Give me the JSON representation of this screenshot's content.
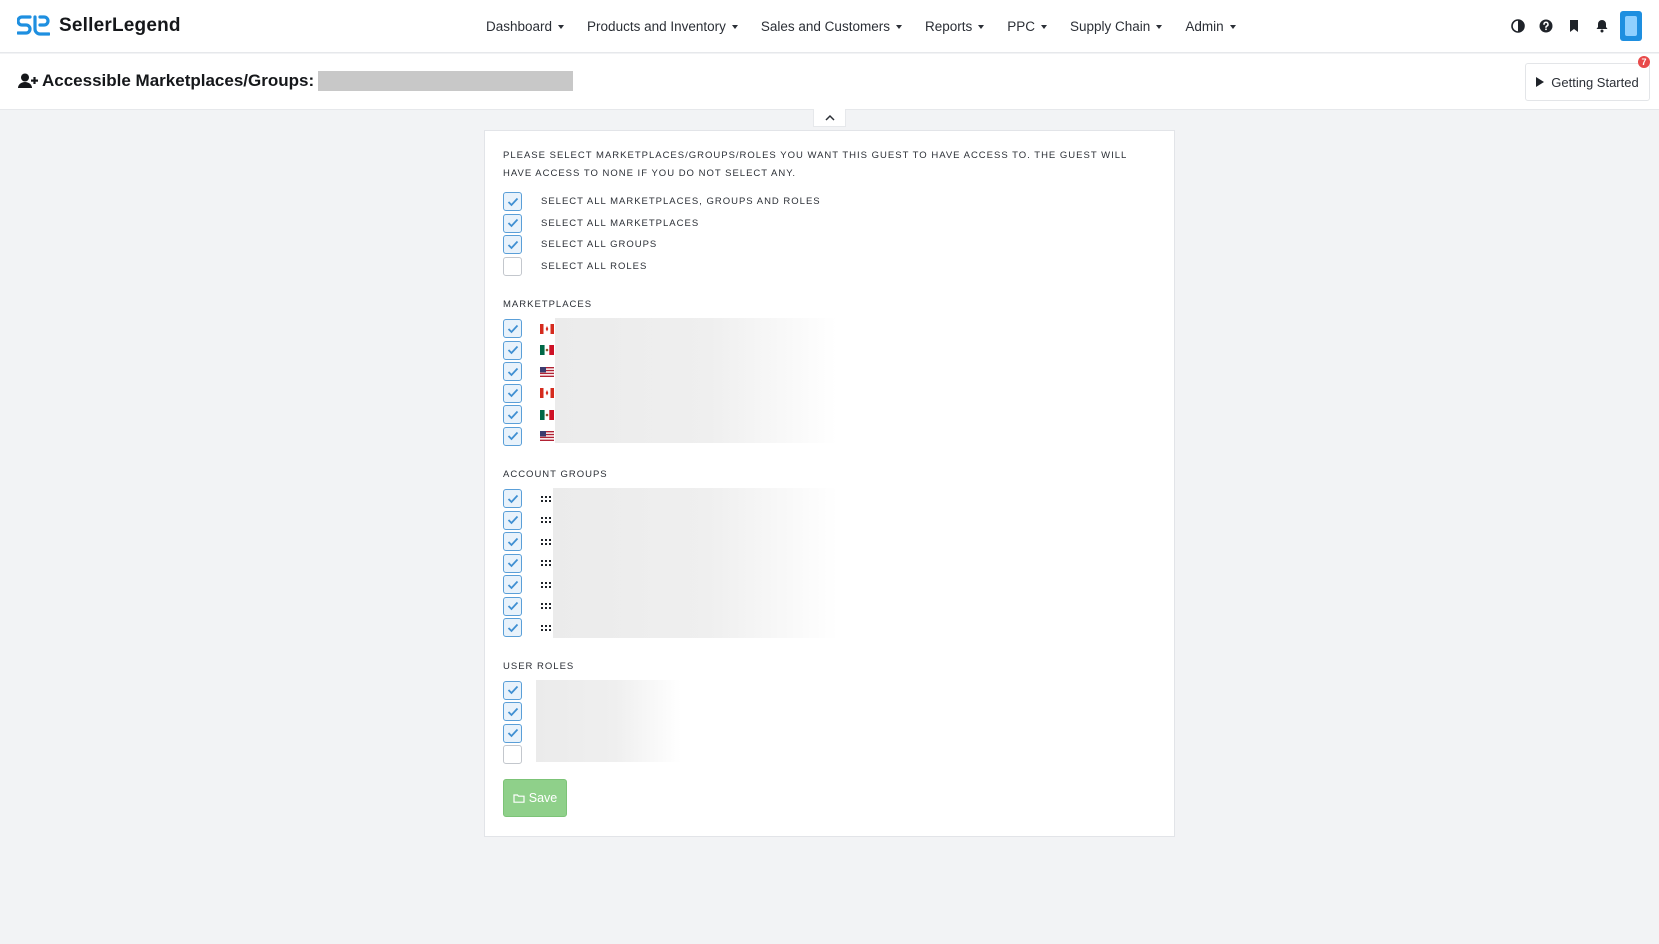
{
  "app": {
    "brand": "SellerLegend",
    "accent": "#1e8fe0"
  },
  "nav": {
    "items": [
      {
        "label": "Dashboard"
      },
      {
        "label": "Products and Inventory"
      },
      {
        "label": "Sales and Customers"
      },
      {
        "label": "Reports"
      },
      {
        "label": "PPC"
      },
      {
        "label": "Supply Chain"
      },
      {
        "label": "Admin"
      }
    ],
    "icons": [
      "contrast-icon",
      "help-icon",
      "bookmark-icon",
      "bell-icon"
    ]
  },
  "header": {
    "title": "Accessible Marketplaces/Groups:",
    "getting_started_label": "Getting Started",
    "badge_count": "7"
  },
  "form": {
    "instructions": "Please select marketplaces/groups/roles you want this guest to have access to. The guest will have access to none if you do not select any.",
    "select_all": [
      {
        "label": "Select all marketplaces, groups and roles",
        "checked": true
      },
      {
        "label": "Select all marketplaces",
        "checked": true
      },
      {
        "label": "Select all groups",
        "checked": true
      },
      {
        "label": "Select all roles",
        "checked": false
      }
    ],
    "marketplaces_title": "Marketplaces",
    "marketplaces": [
      {
        "flag": "ca-flag-icon",
        "checked": true
      },
      {
        "flag": "mx-flag-icon",
        "checked": true
      },
      {
        "flag": "us-flag-icon",
        "checked": true
      },
      {
        "flag": "ca-flag-icon",
        "checked": true
      },
      {
        "flag": "mx-flag-icon",
        "checked": true
      },
      {
        "flag": "us-flag-icon",
        "checked": true
      }
    ],
    "groups_title": "Account Groups",
    "groups": [
      {
        "checked": true
      },
      {
        "checked": true
      },
      {
        "checked": true
      },
      {
        "checked": true
      },
      {
        "checked": true
      },
      {
        "checked": true
      },
      {
        "checked": true
      }
    ],
    "roles_title": "User Roles",
    "roles": [
      {
        "checked": true
      },
      {
        "checked": true
      },
      {
        "checked": true
      },
      {
        "checked": false
      }
    ],
    "save_label": "Save"
  }
}
